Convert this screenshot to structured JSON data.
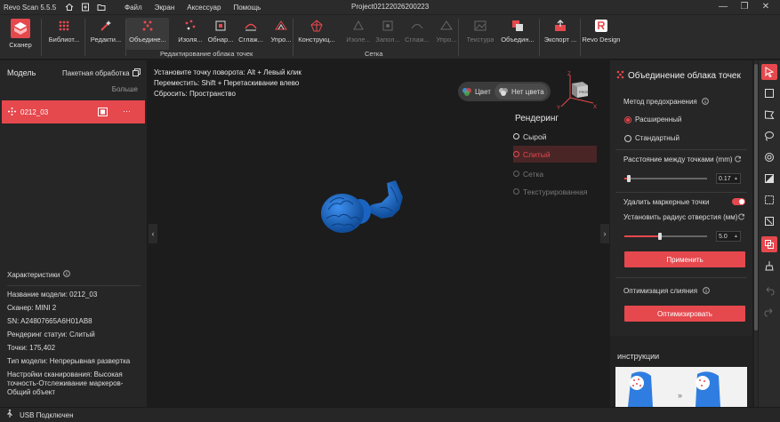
{
  "app": {
    "name": "Revo Scan 5.5.5",
    "project": "Project02122026200223",
    "menu": [
      "Файл",
      "Экран",
      "Аксессуар",
      "Помощь"
    ],
    "window_controls": [
      "—",
      "❐",
      "✕"
    ]
  },
  "toolbar": {
    "scanner": "Сканер",
    "library": "Библиот...",
    "edit": "Редакти...",
    "merge": "Объедине...",
    "isolate": "Изоля...",
    "crop": "Обнар...",
    "smooth": "Сглаж...",
    "simplify": "Упро...",
    "group_point_cloud": "Редактирование облака точек",
    "constructor": "Конструкц...",
    "isolate2": "Изоле...",
    "fill": "Запол...",
    "smooth2": "Сглаж...",
    "simplify2": "Упро...",
    "texture": "Текстура",
    "merge2": "Объедин...",
    "group_mesh": "Сетка",
    "export": "Экспорт ...",
    "revo_design": "Revo Design"
  },
  "left": {
    "title": "Модель",
    "batch": "Пакетная обработка",
    "more": "Больше",
    "model_name": "0212_03",
    "model_menu": "···",
    "chars_title": "Характеристики",
    "props": [
      "Название модели:  0212_03",
      "Сканер:  MINI 2",
      "SN:  A24807665A6H01AB8",
      "Рендеринг статуи:  Слитый",
      "Точки:  175,402",
      "Тип модели:  Непрерывная развертка",
      "Настройки сканирования:  Высокая точность-Отслеживание маркеров-Общий объект"
    ]
  },
  "viewport": {
    "hints": [
      "Установите точку поворота: Alt + Левый клик",
      "Переместить: Shift + Перетаскивание влево",
      "Сбросить: Пространство"
    ],
    "color_on": "Цвет",
    "color_off": "Нет цвета",
    "cube_label": "FRONT",
    "render_title": "Рендеринг",
    "render_options": [
      "Сырой",
      "Слитый",
      "Сетка",
      "Текстурированная"
    ],
    "render_selected": "Слитый",
    "arrow_left": "‹",
    "arrow_right": "›",
    "axis_z": "Z",
    "axis_x": "X",
    "axis_y": "Y",
    "model_color": "#1f6fd1"
  },
  "right": {
    "title": "Объединение облака точек",
    "method_label": "Метод предохранения",
    "method_options": [
      "Расширенный",
      "Стандартный"
    ],
    "method_selected": "Расширенный",
    "distance_label": "Расстояние между точками (mm)",
    "distance_value": "0.17",
    "distance_fraction": 0.05,
    "remove_markers_label": "Удалить маркерные точки",
    "remove_markers_on": true,
    "hole_radius_label": "Установить радиус отверстия (мм)",
    "hole_radius_value": "5.0",
    "hole_radius_fraction": 0.43,
    "apply": "Применить",
    "optimize_label": "Оптимизация слияния",
    "optimize_button": "Оптимизировать",
    "instructions": "инструкции",
    "instr_arrow": "»",
    "accent": "#e5484d"
  },
  "status": {
    "usb": "USB Подключен"
  }
}
